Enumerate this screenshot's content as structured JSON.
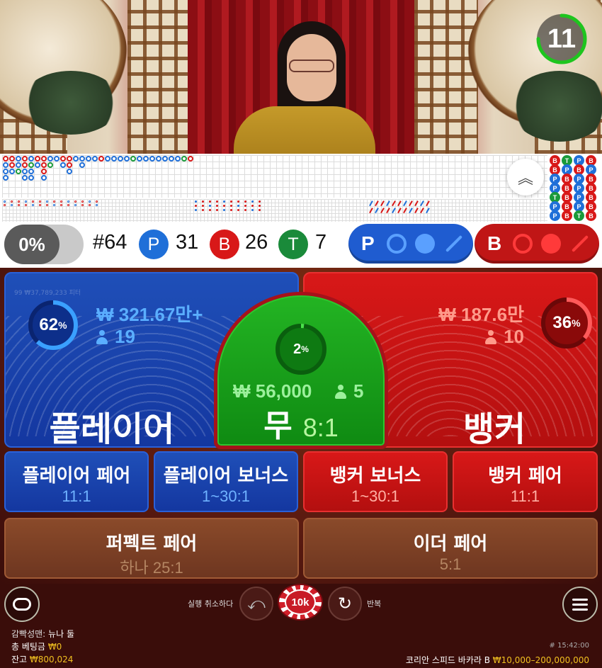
{
  "timer": {
    "seconds": "11",
    "progress": 0.75,
    "color": "#1ec51e"
  },
  "stats": {
    "percent_toggle": "0%",
    "round": "#64",
    "player_letter": "P",
    "player_count": "31",
    "banker_letter": "B",
    "banker_count": "26",
    "tie_letter": "T",
    "tie_count": "7"
  },
  "ask": {
    "player_letter": "P",
    "banker_letter": "B"
  },
  "colors": {
    "player": "#1f6fd8",
    "banker": "#d81818",
    "tie": "#1a8a3a"
  },
  "player": {
    "percent": "62",
    "percent_value": 62,
    "pct_sign": "%",
    "amount": "₩ 321.67만+",
    "players": "19",
    "title": "플레이어",
    "ghost_text": "99 ₩37,789,233 피터"
  },
  "banker": {
    "percent": "36",
    "percent_value": 36,
    "pct_sign": "%",
    "amount": "₩ 187.6만",
    "players": "10",
    "title": "뱅커"
  },
  "tie": {
    "percent": "2",
    "percent_value": 2,
    "pct_sign": "%",
    "amount": "₩ 56,000",
    "players": "5",
    "title": "무",
    "odds": "8:1"
  },
  "side_bets": [
    {
      "name": "플레이어 페어",
      "odds": "11:1"
    },
    {
      "name": "플레이어 보너스",
      "odds": "1~30:1"
    },
    {
      "name": "뱅커 보너스",
      "odds": "1~30:1"
    },
    {
      "name": "뱅커 페어",
      "odds": "11:1"
    },
    {
      "name": "퍼펙트 페어",
      "odds": "하나 25:1"
    },
    {
      "name": "이더 페어",
      "odds": "5:1"
    }
  ],
  "controls": {
    "undo_label": "실행 취소하다",
    "chip_value": "10k",
    "repeat_label": "반복"
  },
  "footer": {
    "dealer_label": "감빡성맨:",
    "dealer_name": "뉴나 둘",
    "total_bet_label": "총 베팅금",
    "total_bet": "₩0",
    "balance_label": "잔고",
    "balance": "₩800,024",
    "round_id": "# 15:42:00",
    "game_name": "코리안 스피드 바카라 B",
    "limits": "₩10,000–200,000,000"
  },
  "bead_road": [
    [
      "B",
      "P",
      "P",
      "P"
    ],
    [
      "B",
      "B",
      "P"
    ],
    [
      "P",
      "P",
      "T"
    ],
    [
      "B",
      "B",
      "P",
      "P"
    ],
    [
      "P",
      "T",
      "P",
      "P"
    ],
    [
      "B",
      "P"
    ],
    [
      "B",
      "B",
      "B",
      "P"
    ],
    [
      "P",
      "T"
    ],
    [
      "P"
    ],
    [
      "B",
      "P"
    ],
    [
      "B",
      "B",
      "P"
    ],
    [
      "P"
    ],
    [
      "P",
      "P"
    ],
    [
      "P"
    ],
    [
      "P"
    ],
    [
      "B"
    ],
    [
      "P"
    ],
    [
      "P"
    ],
    [
      "P"
    ],
    [
      "P"
    ],
    [
      "T"
    ],
    [
      "P"
    ],
    [
      "P"
    ],
    [
      "P"
    ],
    [
      "P"
    ],
    [
      "P"
    ],
    [
      "P"
    ],
    [
      "P"
    ],
    [
      "T"
    ],
    [
      "B"
    ]
  ],
  "mini_road": [
    [
      "B",
      "T",
      "P",
      "B"
    ],
    [
      "B",
      "P",
      "B",
      "P"
    ],
    [
      "P",
      "B",
      "P",
      "B"
    ],
    [
      "P",
      "B",
      "P",
      "B"
    ],
    [
      "T",
      "B",
      "P",
      "B"
    ],
    [
      "P",
      "B",
      "P",
      "B"
    ],
    [
      "P",
      "B",
      "T",
      "B"
    ]
  ]
}
